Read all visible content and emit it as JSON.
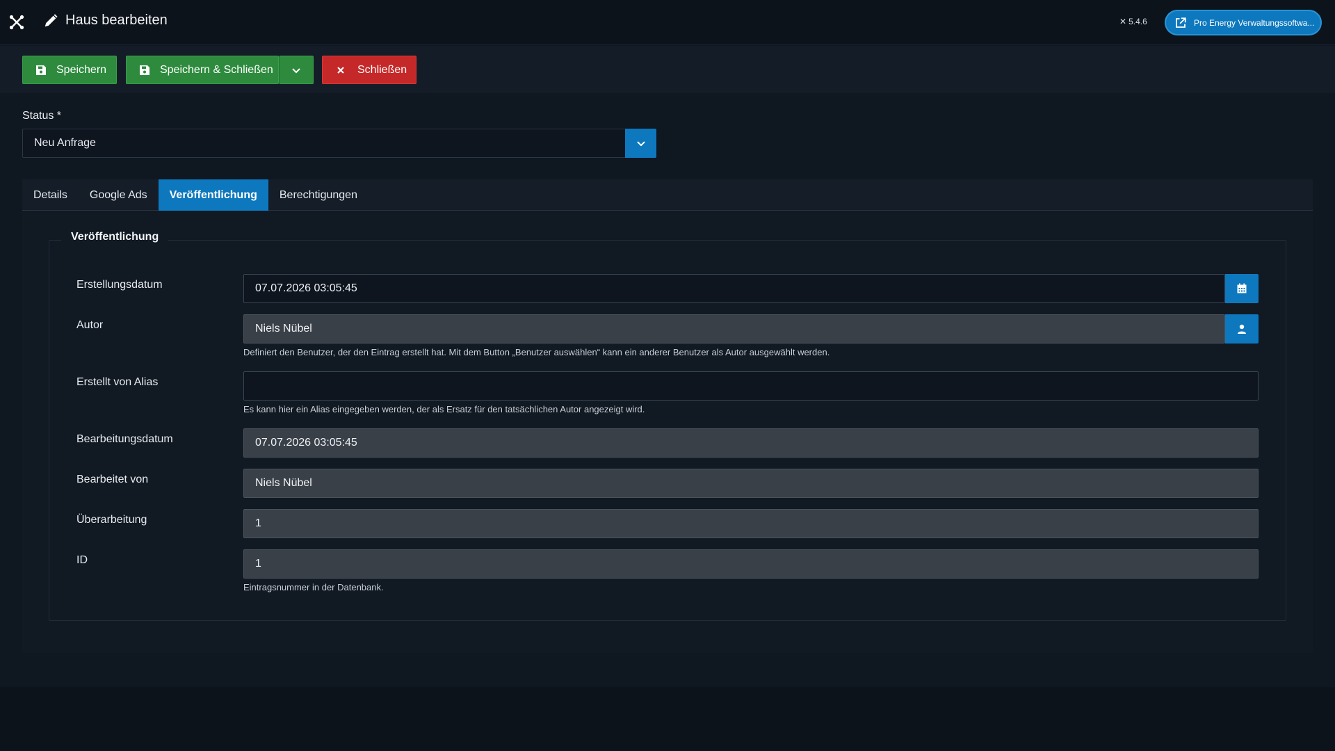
{
  "header": {
    "title": "Haus bearbeiten",
    "version": "5.4.6",
    "site_button": "Pro Energy Verwaltungssoftwa..."
  },
  "toolbar": {
    "save_label": "Speichern",
    "save_close_label": "Speichern & Schließen",
    "close_label": "Schließen"
  },
  "status": {
    "label": "Status *",
    "value": "Neu Anfrage"
  },
  "tabs": [
    {
      "label": "Details",
      "active": false
    },
    {
      "label": "Google Ads",
      "active": false
    },
    {
      "label": "Veröffentlichung",
      "active": true
    },
    {
      "label": "Berechtigungen",
      "active": false
    }
  ],
  "publishing": {
    "legend": "Veröffentlichung",
    "created_label": "Erstellungsdatum",
    "created_value": "07.07.2026 03:05:45",
    "author_label": "Autor",
    "author_value": "Niels Nübel",
    "author_hint": "Definiert den Benutzer, der den Eintrag erstellt hat. Mit dem Button „Benutzer auswählen“ kann ein anderer Benutzer als Autor ausgewählt werden.",
    "alias_label": "Erstellt von Alias",
    "alias_value": "",
    "alias_hint": "Es kann hier ein Alias eingegeben werden, der als Ersatz für den tatsächlichen Autor angezeigt wird.",
    "modified_label": "Bearbeitungsdatum",
    "modified_value": "07.07.2026 03:05:45",
    "modified_by_label": "Bearbeitet von",
    "modified_by_value": "Niels Nübel",
    "revision_label": "Überarbeitung",
    "revision_value": "1",
    "id_label": "ID",
    "id_value": "1",
    "id_hint": "Eintragsnummer in der Datenbank."
  },
  "colors": {
    "accent": "#0d78be",
    "save": "#2e8b3e",
    "close": "#c52828",
    "background": "#0f1721"
  }
}
